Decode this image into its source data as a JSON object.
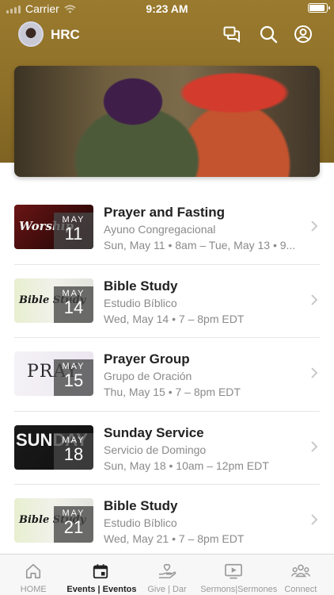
{
  "status_bar": {
    "carrier": "Carrier",
    "time": "9:23 AM"
  },
  "header": {
    "title": "HRC",
    "icons": [
      "chat-icon",
      "search-icon",
      "account-icon"
    ]
  },
  "events": [
    {
      "title": "Prayer and Fasting",
      "subtitle": "Ayuno Congregacional",
      "time": "Sun, May 11 • 8am – Tue, May 13 • 9...",
      "month": "MAY",
      "day": "11",
      "thumb_text": "Worship",
      "thumb_theme": "worship-red"
    },
    {
      "title": "Bible Study",
      "subtitle": "Estudio Bíblico",
      "time": "Wed, May 14 • 7 – 8pm EDT",
      "month": "MAY",
      "day": "14",
      "thumb_text": "Bible Study",
      "thumb_theme": "bible-study"
    },
    {
      "title": "Prayer Group",
      "subtitle": "Grupo de Oración",
      "time": "Thu, May 15 • 7 – 8pm EDT",
      "month": "MAY",
      "day": "15",
      "thumb_text": "PRAY",
      "thumb_theme": "pray"
    },
    {
      "title": "Sunday Service",
      "subtitle": "Servicio de Domingo",
      "time": "Sun, May 18 • 10am – 12pm EDT",
      "month": "MAY",
      "day": "18",
      "thumb_text": "SUNDAY",
      "thumb_theme": "sunday"
    },
    {
      "title": "Bible Study",
      "subtitle": "Estudio Bíblico",
      "time": "Wed, May 21 • 7 – 8pm EDT",
      "month": "MAY",
      "day": "21",
      "thumb_text": "Bible Study",
      "thumb_theme": "bible-study"
    }
  ],
  "tab_bar": {
    "tabs": [
      {
        "label": "HOME",
        "icon": "home-icon",
        "active": false
      },
      {
        "label": "Events | Eventos",
        "icon": "calendar-icon",
        "active": true
      },
      {
        "label": "Give | Dar",
        "icon": "give-icon",
        "active": false
      },
      {
        "label": "Sermons|Sermones",
        "icon": "video-icon",
        "active": false
      },
      {
        "label": "Connect",
        "icon": "people-icon",
        "active": false
      }
    ]
  },
  "colors": {
    "header": "#8e7029",
    "active_tab": "#222222",
    "inactive_tab": "#9a9a9a",
    "accent_red": "#d33b2d"
  }
}
